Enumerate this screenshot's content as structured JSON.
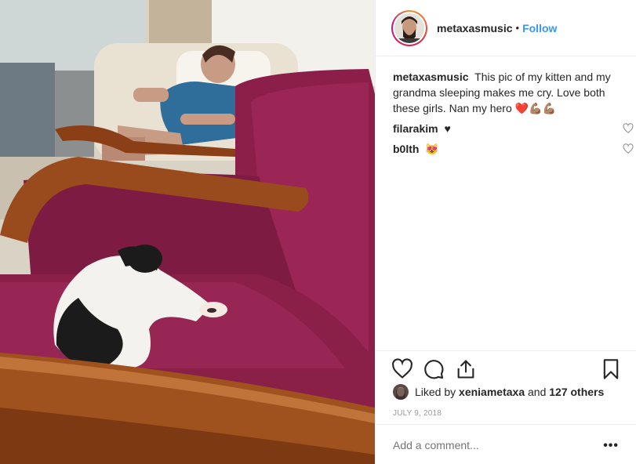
{
  "post": {
    "author": "metaxasmusic",
    "separator": "•",
    "follow_label": "Follow",
    "caption_user": "metaxasmusic",
    "caption_text": "This pic of my kitten and my grandma sleeping makes me cry. Love both these girls. Nan my hero",
    "caption_emoji": "❤️💪🏽💪🏽",
    "photo_alt": "photo"
  },
  "comments": [
    {
      "user": "filarakim",
      "text": "♥"
    },
    {
      "user": "b0lth",
      "text": "😻"
    }
  ],
  "likes": {
    "prefix": "Liked by",
    "user": "xeniametaxa",
    "middle": "and",
    "others": "127 others"
  },
  "date": "JULY 9, 2018",
  "add_comment": {
    "placeholder": "Add a comment..."
  },
  "more_label": "•••",
  "colors": {
    "link": "#3897f0",
    "chair": "#8c1f4a",
    "wood": "#a0521e"
  }
}
